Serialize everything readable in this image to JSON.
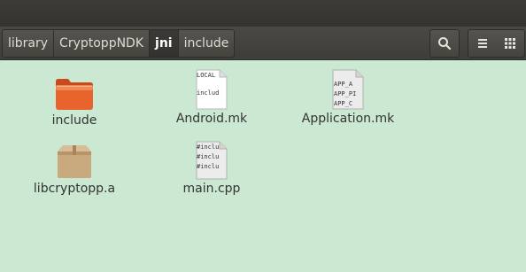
{
  "breadcrumb": [
    "library",
    "CryptoppNDK",
    "jni",
    "include"
  ],
  "active_crumb_index": 2,
  "toolbar": {
    "search_icon": "search-icon",
    "list_view_icon": "list-view-icon",
    "grid_view_icon": "grid-view-icon"
  },
  "files": [
    {
      "name": "include",
      "kind": "folder"
    },
    {
      "name": "Android.mk",
      "kind": "text",
      "preview": [
        "LOCAL",
        "",
        "includ"
      ]
    },
    {
      "name": "Application.mk",
      "kind": "text",
      "preview": [
        "APP_A",
        "APP_PI",
        "APP_C"
      ]
    },
    {
      "name": "libcryptopp.a",
      "kind": "archive"
    },
    {
      "name": "main.cpp",
      "kind": "text",
      "preview": [
        "#inclu",
        "#inclu",
        "#inclu"
      ]
    }
  ],
  "colors": {
    "background": "#cbe8d2",
    "folder": "#e8642c",
    "archive": "#c9a97e",
    "toolbar": "#45443f"
  }
}
